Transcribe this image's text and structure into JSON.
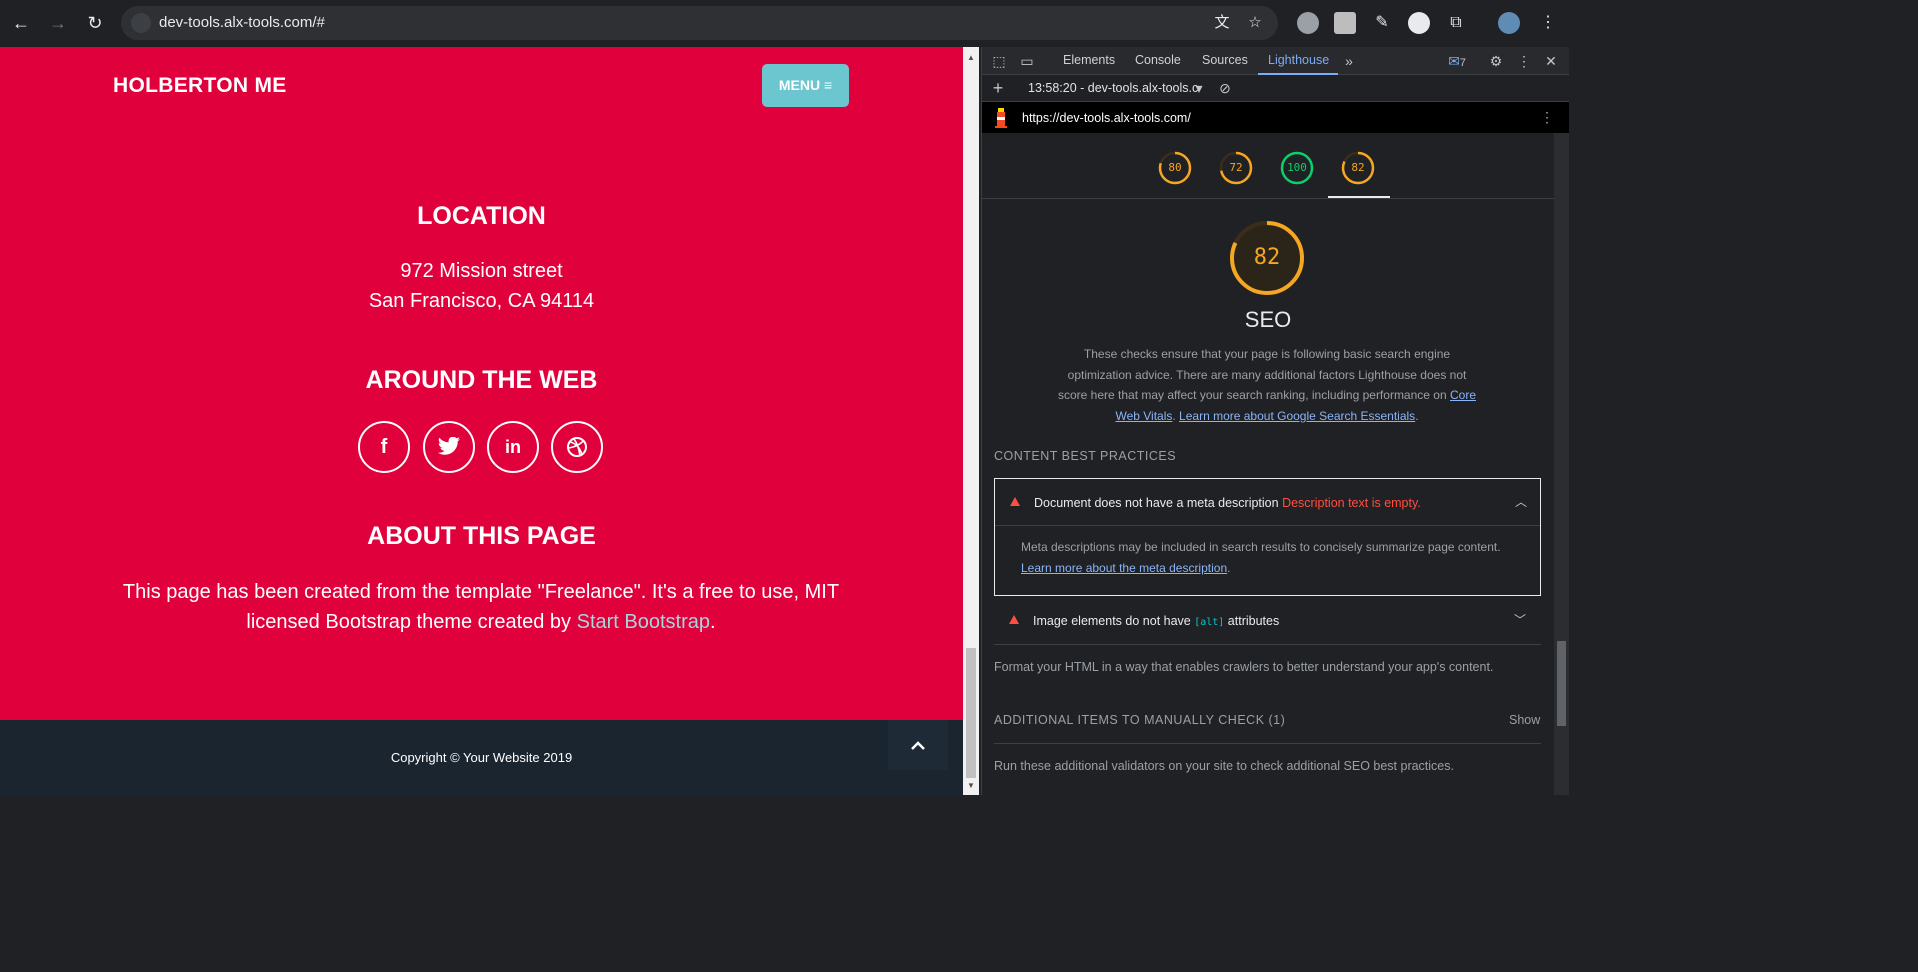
{
  "browser": {
    "url": "dev-tools.alx-tools.com/#"
  },
  "site": {
    "brand": "HOLBERTON ME",
    "menu_label": "MENU ≡",
    "location": {
      "title": "LOCATION",
      "line1": "972 Mission street",
      "line2": "San Francisco, CA 94114"
    },
    "around": {
      "title": "AROUND THE WEB",
      "icons": [
        "facebook-icon",
        "twitter-icon",
        "linkedin-icon",
        "dribbble-icon"
      ]
    },
    "about": {
      "title": "ABOUT THIS PAGE",
      "text": "This page has been created from the template \"Freelance\". It's a free to use, MIT licensed Bootstrap theme created by ",
      "link": "Start Bootstrap",
      "tail": "."
    },
    "footer": {
      "copyright": "Copyright © Your Website 2019"
    }
  },
  "devtools": {
    "tabs": [
      "Elements",
      "Console",
      "Sources",
      "Lighthouse"
    ],
    "active_tab": "Lighthouse",
    "issues_count": "7",
    "run_label": "13:58:20 - dev-tools.alx-tools.c",
    "report_url": "https://dev-tools.alx-tools.com/",
    "gauges": [
      {
        "value": 80,
        "color": "#f5a623"
      },
      {
        "value": 72,
        "color": "#f5a623"
      },
      {
        "value": 100,
        "color": "#0cce6b"
      },
      {
        "value": 82,
        "color": "#f5a623"
      }
    ],
    "seo": {
      "score": "82",
      "title": "SEO",
      "description": "These checks ensure that your page is following basic search engine optimization advice. There are many additional factors Lighthouse does not score here that may affect your search ranking, including performance on ",
      "link1": "Core Web Vitals",
      "sep": ". ",
      "link2": "Learn more about Google Search Essentials",
      "end": "."
    },
    "content_group": "CONTENT BEST PRACTICES",
    "audit1": {
      "title": "Document does not have a meta description",
      "warning": "Description text is empty.",
      "body": "Meta descriptions may be included in search results to concisely summarize page content.",
      "link": "Learn more about the meta description",
      "end": "."
    },
    "audit2": {
      "title_pre": "Image elements do not have ",
      "code": "[alt]",
      "title_post": " attributes"
    },
    "content_note": "Format your HTML in a way that enables crawlers to better understand your app's content.",
    "manual_group": "ADDITIONAL ITEMS TO MANUALLY CHECK (1)",
    "show_label": "Show",
    "manual_note": "Run these additional validators on your site to check additional SEO best practices."
  }
}
